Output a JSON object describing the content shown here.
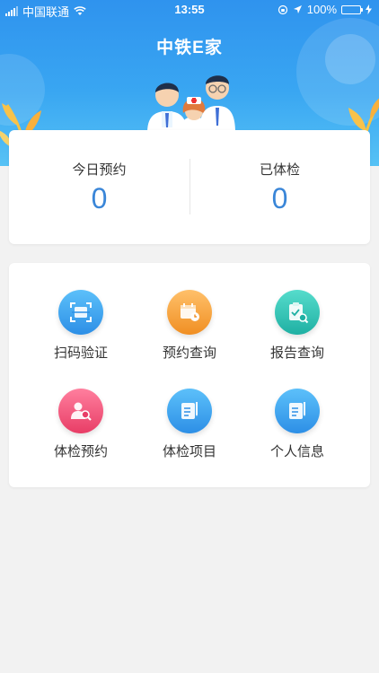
{
  "status_bar": {
    "carrier": "中国联通",
    "time": "13:55",
    "battery": "100%"
  },
  "header": {
    "title": "中铁E家"
  },
  "stats": [
    {
      "label": "今日预约",
      "value": "0"
    },
    {
      "label": "已体检",
      "value": "0"
    }
  ],
  "menu": [
    {
      "label": "扫码验证",
      "icon": "scan-icon",
      "color": "#3aa0ee"
    },
    {
      "label": "预约查询",
      "icon": "calendar-icon",
      "color": "#f4a63a"
    },
    {
      "label": "报告查询",
      "icon": "report-search-icon",
      "color": "#25c3b4"
    },
    {
      "label": "体检预约",
      "icon": "person-search-icon",
      "color": "#f0557a"
    },
    {
      "label": "体检项目",
      "icon": "notebook-icon",
      "color": "#3aa0ee"
    },
    {
      "label": "个人信息",
      "icon": "notebook-icon",
      "color": "#3aa0ee"
    }
  ],
  "colors": {
    "header_blue": "#2f93ee",
    "stat_value": "#3a86d8",
    "background": "#f2f2f2"
  }
}
